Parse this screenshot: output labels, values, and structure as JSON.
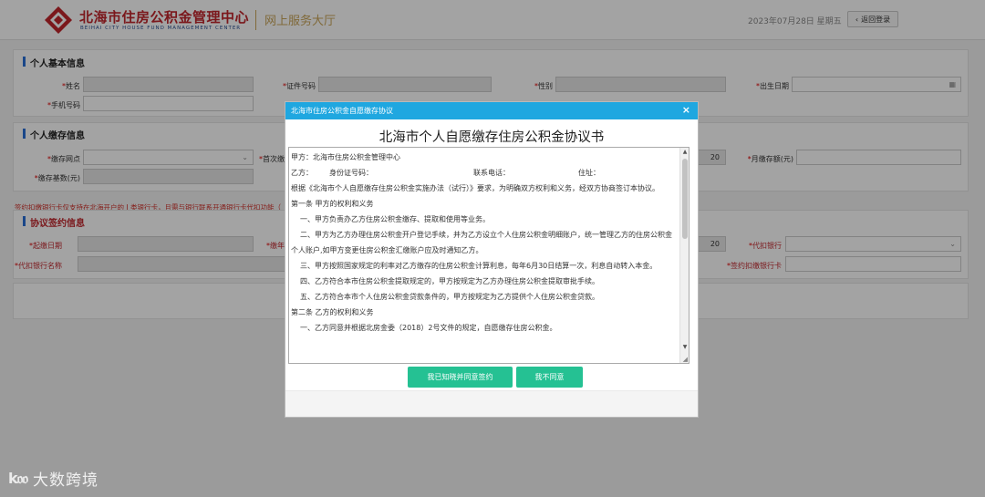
{
  "header": {
    "logo_cn": "北海市住房公积金管理中心",
    "logo_en": "BEIHAI CITY HOUSE FUND MANAGEMENT CENTER",
    "subtitle": "网上服务大厅",
    "date": "2023年07月28日 星期五",
    "back_label": "返回登录"
  },
  "personal": {
    "title": "个人基本信息",
    "name_label": "姓名",
    "id_label": "证件号码",
    "gender_label": "性别",
    "birth_label": "出生日期",
    "phone_label": "手机号码"
  },
  "deposit": {
    "title": "个人缴存信息",
    "site_label": "缴存网点",
    "first_label": "首次缴",
    "monthly_label": "月缴存额(元)",
    "base_label": "缴存基数(元)",
    "value_20": "20"
  },
  "notice": "签约扣缴银行卡仅支持在北海开户的 I 类银行卡，且需与银行联系开通银行卡代扣功能（",
  "agreement": {
    "title": "协议签约信息",
    "start_label": "起缴日期",
    "cut_label": "缴年",
    "bank_label": "代扣银行",
    "bank_name_label": "代扣银行名称",
    "card_label": "签约扣缴银行卡",
    "value_20": "20"
  },
  "modal": {
    "header_title": "北海市住房公积金自愿缴存协议",
    "close": "×",
    "doc_title": "北海市个人自愿缴存住房公积金协议书",
    "lines": {
      "party_a": "甲方：北海市住房公积金管理中心",
      "party_b": "乙方：",
      "id_no": "身份证号码：",
      "phone": "联系电话：",
      "address": "住址：",
      "basis": "根据《北海市个人自愿缴存住房公积金实施办法（试行）》要求，为明确双方权利和义务，经双方协商签订本协议。",
      "art1": "第一条  甲方的权利和义务",
      "a1": "一、甲方负责办乙方住房公积金缴存、提取和使用等业务。",
      "a2": "二、甲方为乙方办理住房公积金开户登记手续，并为乙方设立个人住房公积金明细账户，统一管理乙方的住房公积金个人账户,如甲方变更住房公积金汇缴账户应及时通知乙方。",
      "a3": "三、甲方按照国家规定的利率对乙方缴存的住房公积金计算利息，每年6月30日结算一次，利息自动转入本金。",
      "a4": "四、乙方符合本市住房公积金提取规定的，甲方按规定为乙方办理住房公积金提取审批手续。",
      "a5": "五、乙方符合本市个人住房公积金贷款条件的，甲方按规定为乙方提供个人住房公积金贷款。",
      "art2": "第二条  乙方的权利和义务",
      "b1": "一、乙方同意并根据北房金委（2018）2号文件的规定，自愿缴存住房公积金。"
    },
    "agree_button": "我已知晓并同意签约",
    "decline_button": "我不同意"
  },
  "watermark": {
    "logo": "k𝔬𝔬",
    "text": "大数跨境"
  },
  "colors": {
    "brand_red": "#c0262d",
    "modal_header": "#1fa7e0",
    "button_green": "#25c193",
    "gold": "#c8a55a"
  }
}
